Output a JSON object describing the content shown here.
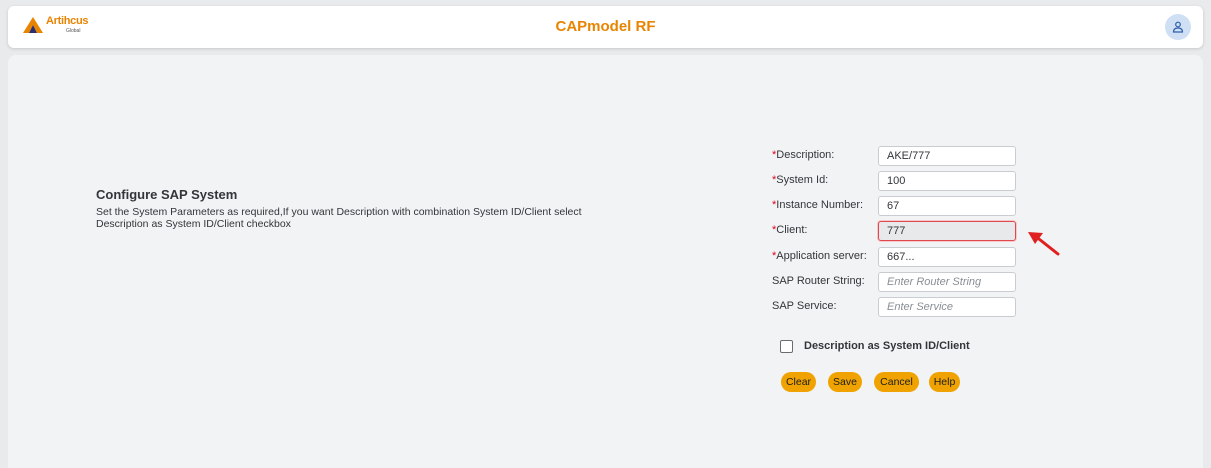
{
  "header": {
    "logo_text": "Artihcus",
    "logo_sub": "Global",
    "title": "CAPmodel RF",
    "user_icon": "user-icon"
  },
  "config": {
    "title": "Configure SAP System",
    "description": "Set the System Parameters as required,If you want Description with combination System ID/Client select Description as System ID/Client checkbox"
  },
  "form": {
    "description": {
      "required": "*",
      "label": "Description:",
      "value": "AKE/777"
    },
    "system_id": {
      "required": "*",
      "label": "System Id:",
      "value": "100"
    },
    "instance_number": {
      "required": "*",
      "label": "Instance Number:",
      "value": "67"
    },
    "client": {
      "required": "*",
      "label": "Client:",
      "value": "777"
    },
    "application_server": {
      "required": "*",
      "label": "Application server:",
      "value": "667..."
    },
    "router_string": {
      "label": "SAP Router String:",
      "placeholder": "Enter Router String"
    },
    "service": {
      "label": "SAP Service:",
      "placeholder": "Enter Service"
    }
  },
  "checkbox": {
    "label": "Description as System ID/Client",
    "checked": false
  },
  "buttons": {
    "clear": "Clear",
    "save": "Save",
    "cancel": "Cancel",
    "help": "Help"
  },
  "colors": {
    "accent": "#e98400",
    "button": "#f0a300",
    "highlight": "#e0484e",
    "arrow": "#e02020"
  }
}
